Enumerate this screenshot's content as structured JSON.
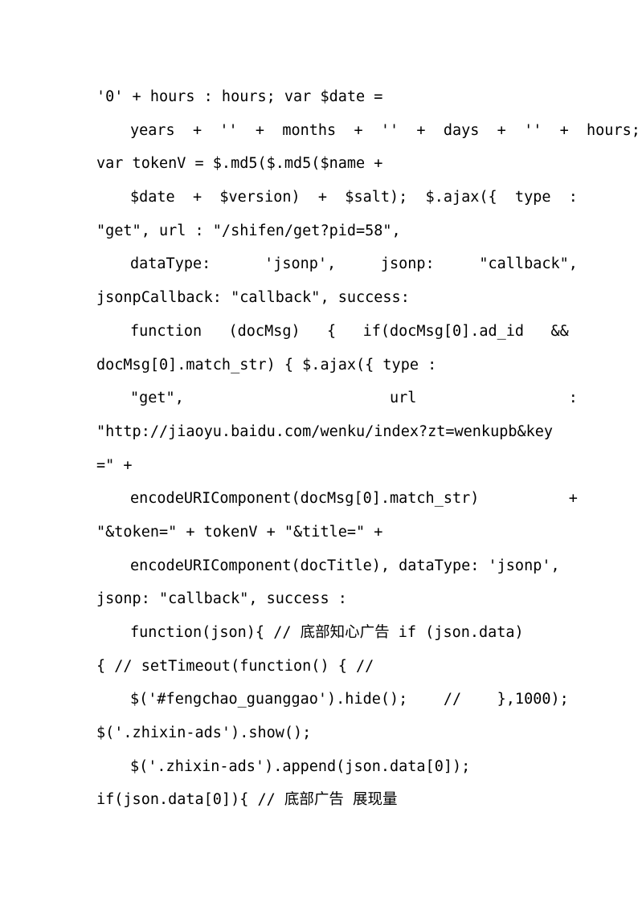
{
  "document": {
    "page_number": 1,
    "background_color": "#ffffff",
    "text_color": "#000000",
    "content_type": "javascript-source-code",
    "lines": [
      {
        "id": "line-1",
        "indent": false,
        "text": "'0' + hours : hours; var $date ="
      },
      {
        "id": "line-2",
        "indent": true,
        "text": "years  +  ''  +  months  +  ''  +  days  +  ''  +  hours;"
      },
      {
        "id": "line-3",
        "indent": false,
        "text": "var tokenV = $.md5($.md5($name +"
      },
      {
        "id": "line-4",
        "indent": true,
        "text": "$date  +  $version)  +  $salt);  $.ajax({  type  :"
      },
      {
        "id": "line-5",
        "indent": false,
        "text": "\"get\", url : \"/shifen/get?pid=58\","
      },
      {
        "id": "line-6",
        "indent": true,
        "text": "dataType:      'jsonp',     jsonp:     \"callback\","
      },
      {
        "id": "line-7",
        "indent": false,
        "text": "jsonpCallback: \"callback\", success:"
      },
      {
        "id": "line-8",
        "indent": true,
        "text": "function   (docMsg)   {   if(docMsg[0].ad_id   &&"
      },
      {
        "id": "line-9",
        "indent": false,
        "text": "docMsg[0].match_str) { $.ajax({ type :"
      },
      {
        "id": "line-10",
        "indent": true,
        "text": "\"get\",                       url                 :"
      },
      {
        "id": "line-11",
        "indent": false,
        "text": "\"http://jiaoyu.baidu.com/wenku/index?zt=wenkupb&key"
      },
      {
        "id": "line-12",
        "indent": false,
        "text": "=\" +"
      },
      {
        "id": "line-13",
        "indent": true,
        "text": "encodeURIComponent(docMsg[0].match_str)          +"
      },
      {
        "id": "line-14",
        "indent": false,
        "text": "\"&token=\" + tokenV + \"&title=\" +"
      },
      {
        "id": "line-15",
        "indent": true,
        "text": "encodeURIComponent(docTitle), dataType: 'jsonp',"
      },
      {
        "id": "line-16",
        "indent": false,
        "text": "jsonp: \"callback\", success :"
      },
      {
        "id": "line-17",
        "indent": true,
        "text": "function(json){ // 底部知心广告 if (json.data)"
      },
      {
        "id": "line-18",
        "indent": false,
        "text": "{ // setTimeout(function() { //"
      },
      {
        "id": "line-19",
        "indent": true,
        "text": "$('#fengchao_guanggao').hide();    //    },1000);"
      },
      {
        "id": "line-20",
        "indent": false,
        "text": "$('.zhixin-ads').show();"
      },
      {
        "id": "line-21",
        "indent": true,
        "text": "$('.zhixin-ads').append(json.data[0]);"
      },
      {
        "id": "line-22",
        "indent": false,
        "text": "if(json.data[0]){ // 底部广告 展现量"
      }
    ]
  }
}
